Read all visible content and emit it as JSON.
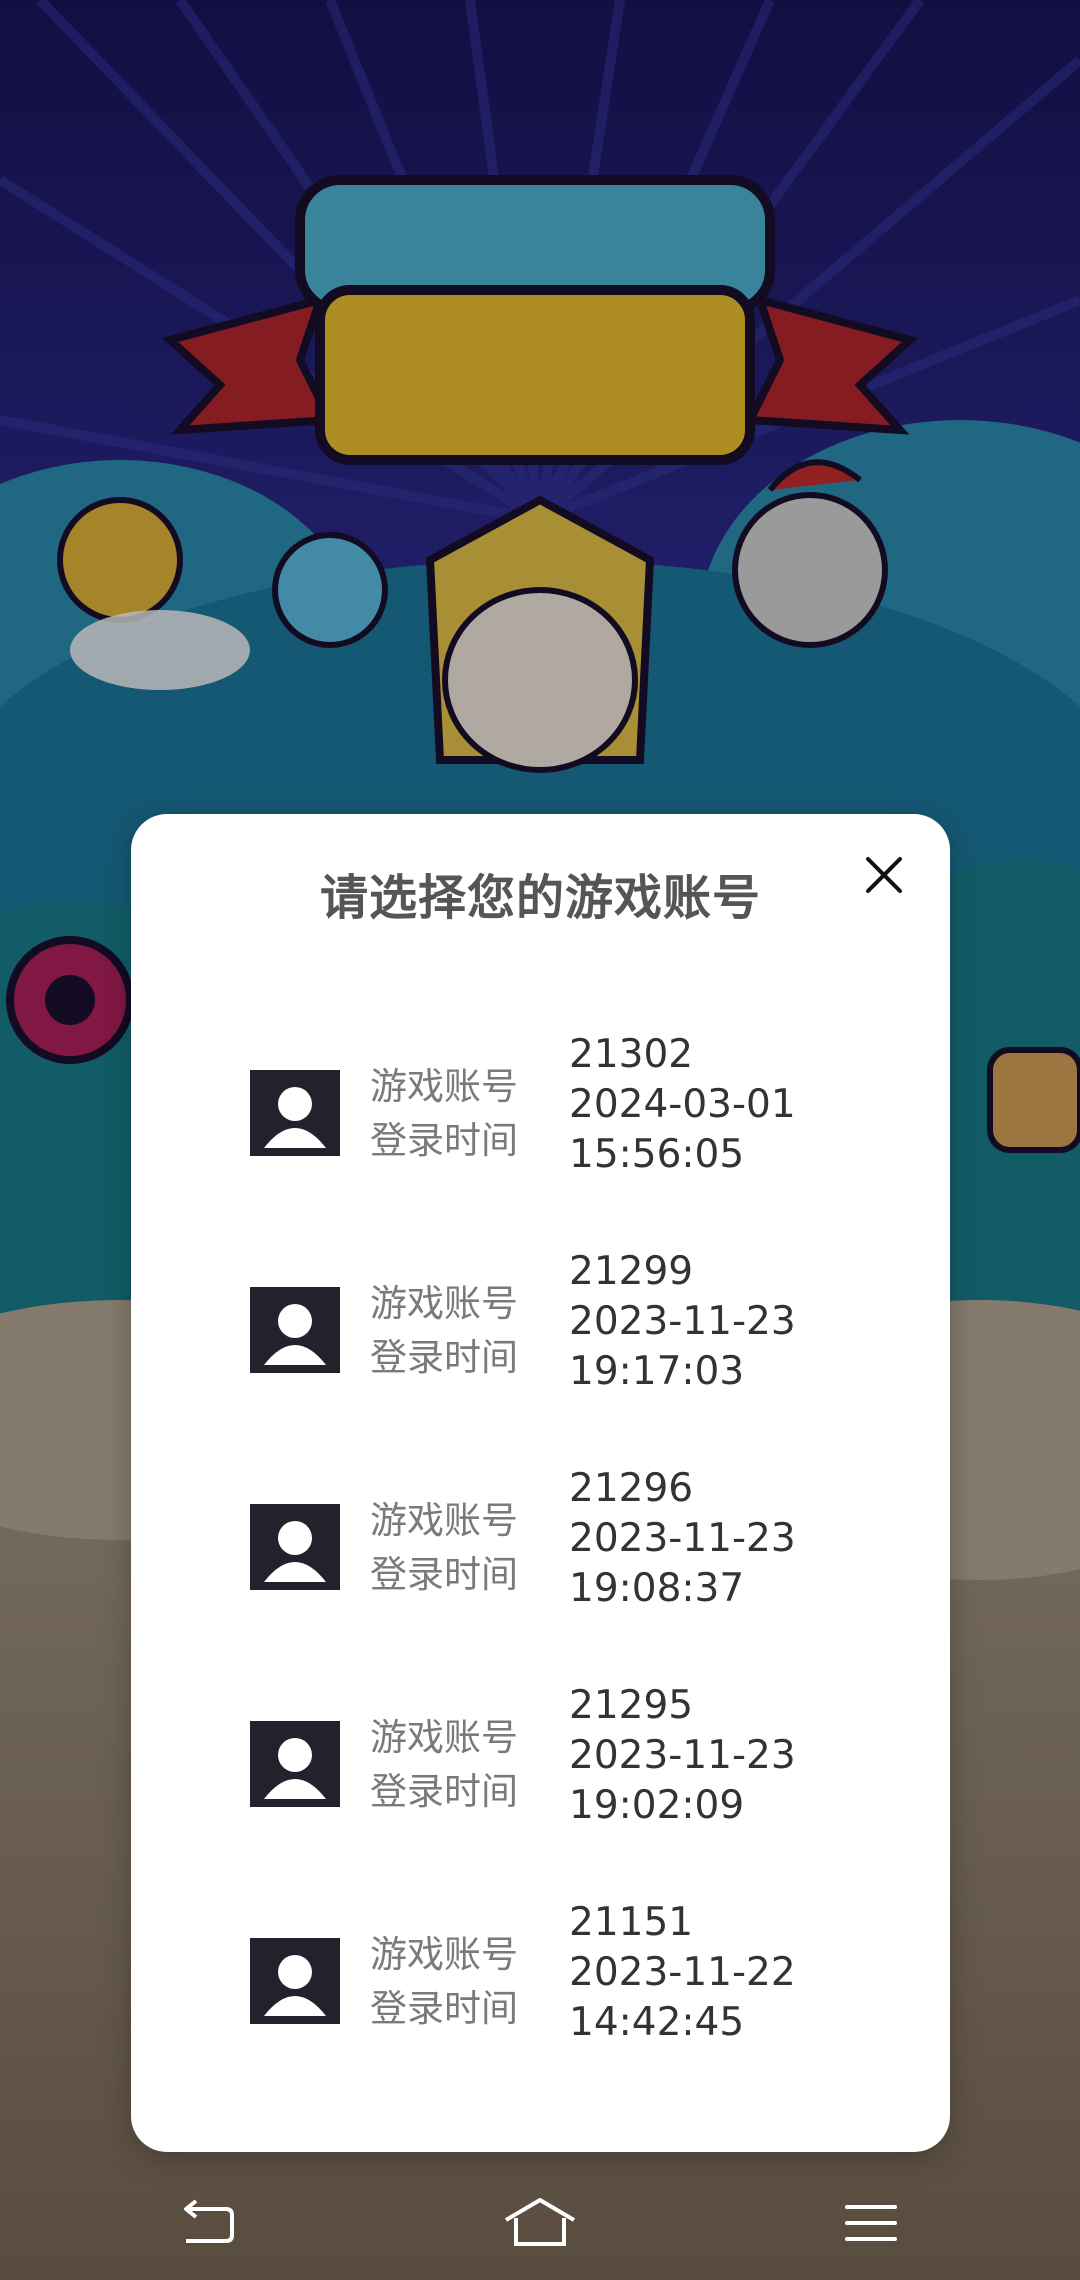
{
  "dialog": {
    "title": "请选择您的游戏账号",
    "account_label": "游戏账号",
    "login_time_label": "登录时间"
  },
  "accounts": [
    {
      "id": "21302",
      "date": "2024-03-01",
      "time": "15:56:05"
    },
    {
      "id": "21299",
      "date": "2023-11-23",
      "time": "19:17:03"
    },
    {
      "id": "21296",
      "date": "2023-11-23",
      "time": "19:08:37"
    },
    {
      "id": "21295",
      "date": "2023-11-23",
      "time": "19:02:09"
    },
    {
      "id": "21151",
      "date": "2023-11-22",
      "time": "14:42:45"
    }
  ],
  "navbar": {
    "back_icon": "back-arrow-icon",
    "home_icon": "home-icon",
    "menu_icon": "menu-icon"
  },
  "colors": {
    "dialog_bg": "#ffffff",
    "title_text": "#555555",
    "label_text": "#7a7a7a",
    "value_text": "#333333",
    "avatar_bg": "#22222c",
    "scrim": "rgba(0,0,0,0.28)"
  }
}
